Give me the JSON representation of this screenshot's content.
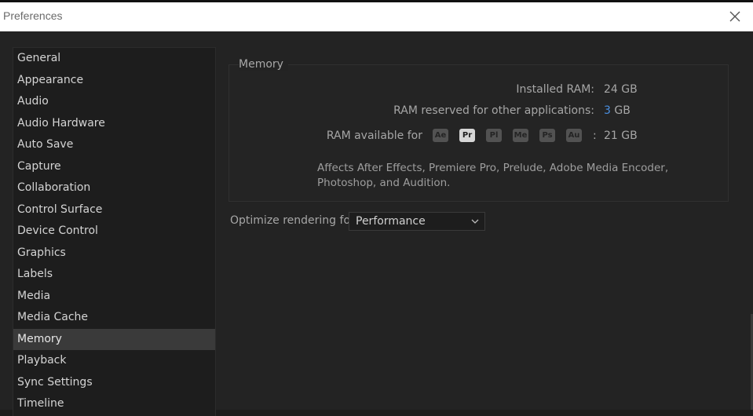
{
  "window": {
    "title": "Preferences",
    "close_icon": "close-icon"
  },
  "sidebar": {
    "items": [
      {
        "label": "General"
      },
      {
        "label": "Appearance"
      },
      {
        "label": "Audio"
      },
      {
        "label": "Audio Hardware"
      },
      {
        "label": "Auto Save"
      },
      {
        "label": "Capture"
      },
      {
        "label": "Collaboration"
      },
      {
        "label": "Control Surface"
      },
      {
        "label": "Device Control"
      },
      {
        "label": "Graphics"
      },
      {
        "label": "Labels"
      },
      {
        "label": "Media"
      },
      {
        "label": "Media Cache"
      },
      {
        "label": "Memory",
        "selected": true
      },
      {
        "label": "Playback"
      },
      {
        "label": "Sync Settings"
      },
      {
        "label": "Timeline"
      }
    ]
  },
  "memory": {
    "group_title": "Memory",
    "installed_label": "Installed RAM:",
    "installed_value": "24 GB",
    "reserved_label": "RAM reserved for other applications:",
    "reserved_value": "3",
    "reserved_unit": "GB",
    "available_label": "RAM available for",
    "available_sep": ":",
    "available_value": "21 GB",
    "apps": [
      {
        "code": "Ae",
        "active": false
      },
      {
        "code": "Pr",
        "active": true
      },
      {
        "code": "Pl",
        "active": false
      },
      {
        "code": "Me",
        "active": false
      },
      {
        "code": "Ps",
        "active": false
      },
      {
        "code": "Au",
        "active": false
      }
    ],
    "note_line1": "Affects After Effects, Premiere Pro, Prelude, Adobe Media Encoder,",
    "note_line2": "Photoshop, and Audition."
  },
  "rendering": {
    "label": "Optimize rendering for:",
    "value": "Performance",
    "chevron_icon": "chevron-down-icon"
  },
  "colors": {
    "accent_blue": "#4a8fe0",
    "panel_bg": "#232323",
    "selected_item_bg": "#3a3a3a"
  }
}
